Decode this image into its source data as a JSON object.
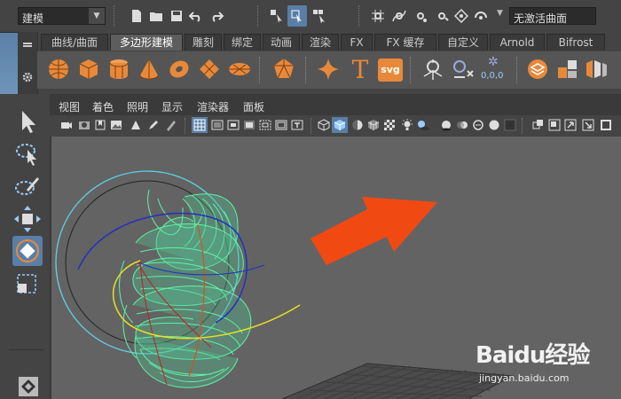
{
  "status_line": {
    "mode_menu_value": "建模",
    "object_name_field_value": "无激活曲面"
  },
  "shelf": {
    "tabs": [
      {
        "label": "曲线/曲面",
        "active": false
      },
      {
        "label": "多边形建模",
        "active": true
      },
      {
        "label": "雕刻",
        "active": false
      },
      {
        "label": "绑定",
        "active": false
      },
      {
        "label": "动画",
        "active": false
      },
      {
        "label": "渲染",
        "active": false
      },
      {
        "label": "FX",
        "active": false
      },
      {
        "label": "FX 缓存",
        "active": false
      },
      {
        "label": "自定义",
        "active": false
      },
      {
        "label": "Arnold",
        "active": false
      },
      {
        "label": "Bifrost",
        "active": false
      }
    ],
    "text_icon_label": "T",
    "svg_icon_label": "svg",
    "uv_icon_label": "0,0,0"
  },
  "viewport": {
    "menu": [
      "视图",
      "着色",
      "照明",
      "显示",
      "渲染器",
      "面板"
    ]
  },
  "watermark": {
    "brand": "Baidu经验",
    "url": "jingyan.baidu.com"
  },
  "colors": {
    "accent_orange": "#e8893a",
    "active_tool": "#5a7fa6",
    "wireframe_green": "#5ef2a8",
    "arrow_red": "#f04a12"
  }
}
